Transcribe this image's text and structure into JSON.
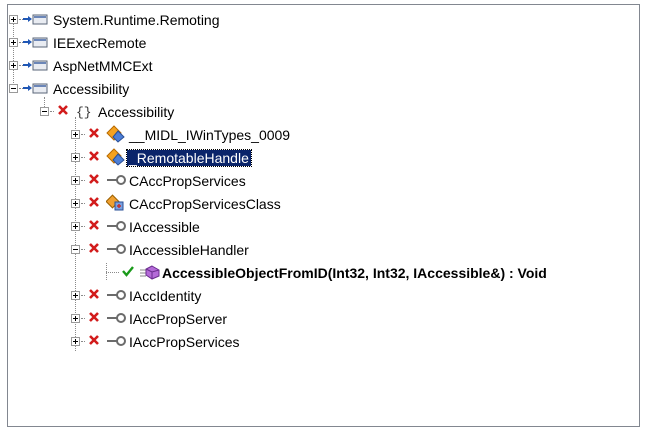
{
  "nodes": [
    {
      "label": "System.Runtime.Remoting"
    },
    {
      "label": "IEExecRemote"
    },
    {
      "label": "AspNetMMCExt"
    },
    {
      "label": "Accessibility"
    },
    {
      "label": "Accessibility"
    },
    {
      "label": "__MIDL_IWinTypes_0009"
    },
    {
      "label": "_RemotableHandle"
    },
    {
      "label": "CAccPropServices"
    },
    {
      "label": "CAccPropServicesClass"
    },
    {
      "label": "IAccessible"
    },
    {
      "label": "IAccessibleHandler"
    },
    {
      "label": "AccessibleObjectFromID(Int32, Int32, IAccessible&) : Void"
    },
    {
      "label": "IAccIdentity"
    },
    {
      "label": "IAccPropServer"
    },
    {
      "label": "IAccPropServices"
    }
  ],
  "icons": {
    "assembly": "assembly-icon",
    "namespace": "namespace-icon",
    "struct": "struct-icon",
    "class": "class-icon",
    "coclass": "coclass-icon",
    "interface": "interface-icon",
    "method": "method-icon",
    "status_error": "x-mark-icon",
    "status_ok": "check-icon"
  },
  "colors": {
    "selection": "#0a246a",
    "error_mark": "#d21c1c",
    "ok_mark": "#1a9a1a",
    "assembly_arrow": "#1f57b5",
    "struct_icon": "#f08a00",
    "class_icon": "#e07b00",
    "method_icon": "#a050c8"
  }
}
